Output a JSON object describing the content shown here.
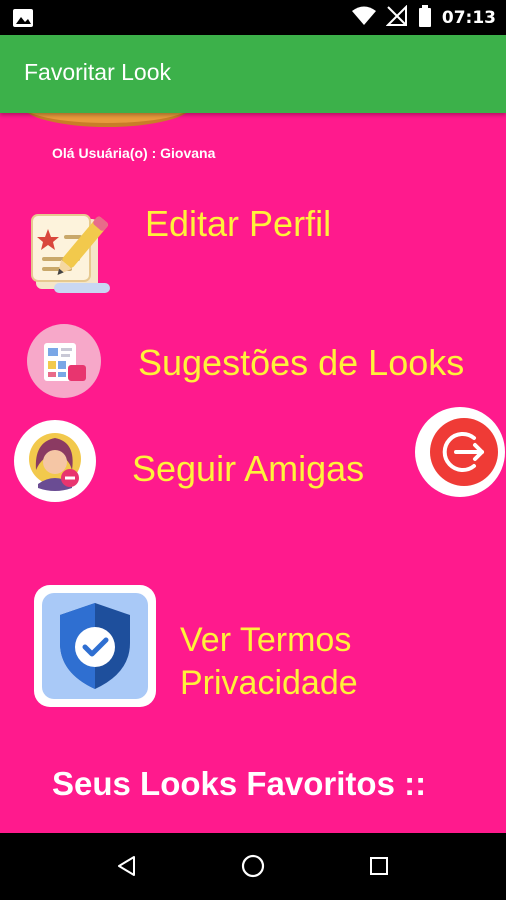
{
  "status_bar": {
    "time": "07:13",
    "icons": [
      "image-icon",
      "wifi-icon",
      "no-signal-icon",
      "battery-icon"
    ]
  },
  "app_bar": {
    "title": "Favoritar Look"
  },
  "greeting": "Olá Usuária(o) : Giovana",
  "menu": {
    "edit_profile": "Editar Perfil",
    "look_suggestions": "Sugestões de Looks",
    "follow_friends": "Seguir Amigas",
    "privacy_terms_line1": "Ver Termos",
    "privacy_terms_line2": "Privacidade"
  },
  "favorites_heading": "Seus Looks Favoritos ::",
  "colors": {
    "app_bar": "#3cb14a",
    "background": "#ff1a8d",
    "menu_text": "#fff23a",
    "logout_red": "#ef3b36"
  },
  "nav_bar": {
    "icons": [
      "back-icon",
      "home-icon",
      "recents-icon"
    ]
  }
}
